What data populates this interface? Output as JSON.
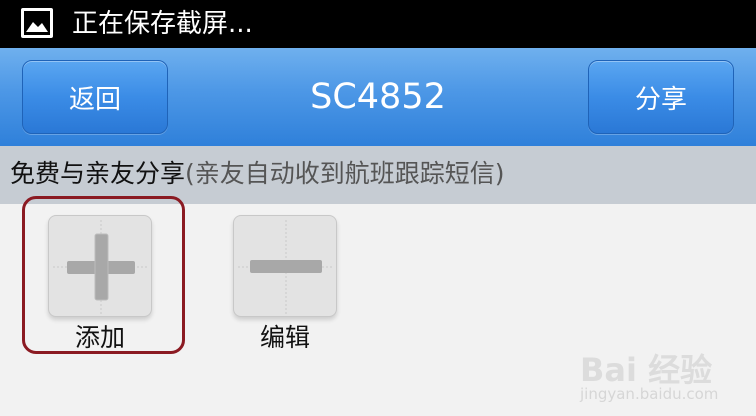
{
  "status_bar": {
    "notification_text": "正在保存截屏...",
    "icon": "image-icon"
  },
  "title_bar": {
    "back_label": "返回",
    "title": "SC4852",
    "share_label": "分享"
  },
  "section": {
    "main_text": "免费与亲友分享",
    "sub_text": "(亲友自动收到航班跟踪短信)"
  },
  "tiles": [
    {
      "label": "添加",
      "icon": "plus-icon"
    },
    {
      "label": "编辑",
      "icon": "minus-icon"
    }
  ],
  "watermark": {
    "main": "Bai 经验",
    "sub": "jingyan.baidu.com"
  },
  "colors": {
    "titlebar": "#3a8ce2",
    "section_bg": "#c6ccd3",
    "highlight": "#8b1a22"
  }
}
